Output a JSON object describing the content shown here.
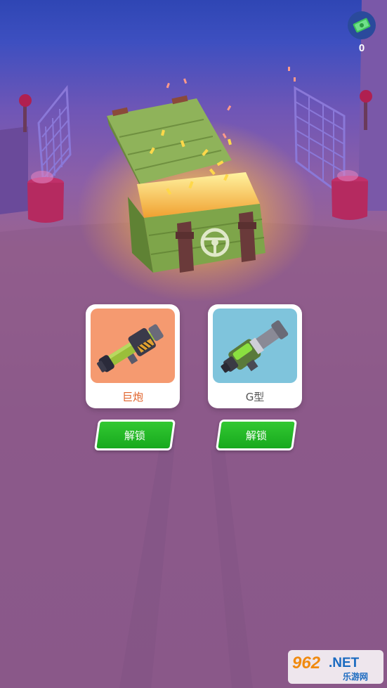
{
  "hud": {
    "currency_icon": "cash-stack-icon",
    "currency_amount": "0"
  },
  "chest": {
    "icon": "steering-wheel-icon"
  },
  "rewards": [
    {
      "name": "巨炮",
      "name_color": "#e0622a",
      "thumb_bg": "#f59a70",
      "unlock_label": "解锁"
    },
    {
      "name": "G型",
      "name_color": "#555555",
      "thumb_bg": "#7fc4dc",
      "unlock_label": "解锁"
    }
  ],
  "watermark": {
    "logo_text": "962.NET",
    "sub_text": "乐游网"
  },
  "colors": {
    "button_green": "#22b524",
    "chest_green": "#7fa84a",
    "glow": "#ffd04a"
  }
}
